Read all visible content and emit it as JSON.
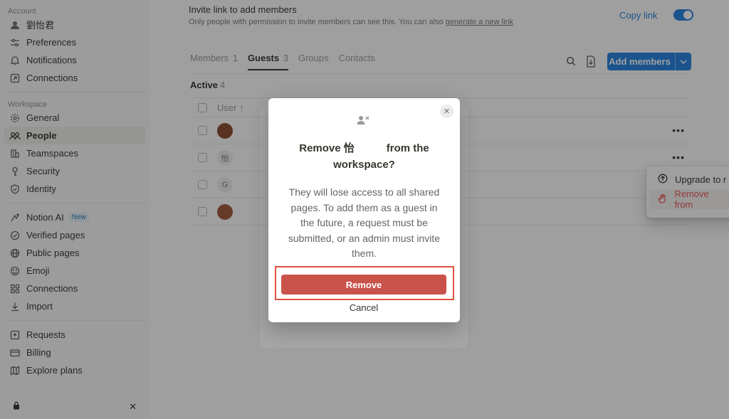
{
  "sidebar": {
    "account_section": "Account",
    "account_items": [
      {
        "label": "劉怡君",
        "icon": "user-avatar-icon"
      },
      {
        "label": "Preferences",
        "icon": "sliders-icon"
      },
      {
        "label": "Notifications",
        "icon": "bell-icon"
      },
      {
        "label": "Connections",
        "icon": "external-link-icon"
      }
    ],
    "workspace_section": "Workspace",
    "workspace_items": [
      {
        "label": "General",
        "icon": "gear-icon"
      },
      {
        "label": "People",
        "icon": "people-icon",
        "active": true
      },
      {
        "label": "Teamspaces",
        "icon": "building-icon"
      },
      {
        "label": "Security",
        "icon": "key-icon"
      },
      {
        "label": "Identity",
        "icon": "shield-icon"
      }
    ],
    "feature_items": [
      {
        "label": "Notion AI",
        "icon": "ai-sparkle-icon",
        "badge": "New"
      },
      {
        "label": "Verified pages",
        "icon": "verified-icon"
      },
      {
        "label": "Public pages",
        "icon": "globe-icon"
      },
      {
        "label": "Emoji",
        "icon": "smiley-icon"
      },
      {
        "label": "Connections",
        "icon": "grid-icon"
      },
      {
        "label": "Import",
        "icon": "download-icon"
      }
    ],
    "admin_items": [
      {
        "label": "Requests",
        "icon": "inbox-icon"
      },
      {
        "label": "Billing",
        "icon": "card-icon"
      },
      {
        "label": "Explore plans",
        "icon": "map-icon"
      }
    ]
  },
  "invite": {
    "title": "Invite link to add members",
    "subtitle_prefix": "Only people with permission to invite members can see this. You can also ",
    "subtitle_link": "generate a new link",
    "copy_link": "Copy link"
  },
  "tabs": [
    {
      "label": "Members",
      "count": "1"
    },
    {
      "label": "Guests",
      "count": "3",
      "active": true
    },
    {
      "label": "Groups",
      "count": ""
    },
    {
      "label": "Contacts",
      "count": ""
    }
  ],
  "add_members_label": "Add members",
  "active": {
    "label": "Active",
    "count": "4"
  },
  "table": {
    "header_user": "User ↑",
    "rows": [
      {
        "avatar_text": "",
        "avatar_kind": "photo"
      },
      {
        "avatar_text": "怡",
        "avatar_kind": "initial"
      },
      {
        "avatar_text": "G",
        "avatar_kind": "initial"
      },
      {
        "avatar_text": "",
        "avatar_kind": "photo2"
      }
    ]
  },
  "context_menu": {
    "upgrade": "Upgrade to r",
    "remove": "Remove from"
  },
  "dialog": {
    "title": "Remove 怡　　　from the workspace?",
    "body": "They will lose access to all shared pages. To add them as a guest in the future, a request must be submitted, or an admin must invite them.",
    "remove_label": "Remove",
    "cancel_label": "Cancel",
    "highlight_color": "#e2513d",
    "remove_color": "#c9524b"
  }
}
